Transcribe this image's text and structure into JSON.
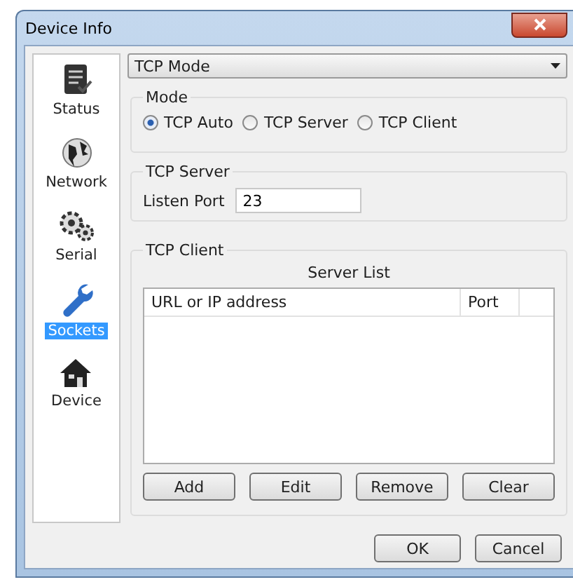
{
  "window": {
    "title": "Device Info"
  },
  "sidebar": {
    "items": [
      {
        "label": "Status",
        "kind": "status",
        "selected": false
      },
      {
        "label": "Network",
        "kind": "network",
        "selected": false
      },
      {
        "label": "Serial",
        "kind": "serial",
        "selected": false
      },
      {
        "label": "Sockets",
        "kind": "sockets",
        "selected": true
      },
      {
        "label": "Device",
        "kind": "device",
        "selected": false
      }
    ]
  },
  "mode_select": {
    "value": "TCP Mode"
  },
  "mode_group": {
    "title": "Mode",
    "options": [
      {
        "label": "TCP Auto",
        "selected": true
      },
      {
        "label": "TCP Server",
        "selected": false
      },
      {
        "label": "TCP Client",
        "selected": false
      }
    ]
  },
  "server_group": {
    "title": "TCP Server",
    "field_label": "Listen Port",
    "value": "23"
  },
  "client_group": {
    "title": "TCP Client",
    "list_title": "Server List",
    "columns": [
      "URL or IP address",
      "Port"
    ],
    "buttons": [
      "Add",
      "Edit",
      "Remove",
      "Clear"
    ]
  },
  "buttons": [
    "OK",
    "Cancel"
  ]
}
